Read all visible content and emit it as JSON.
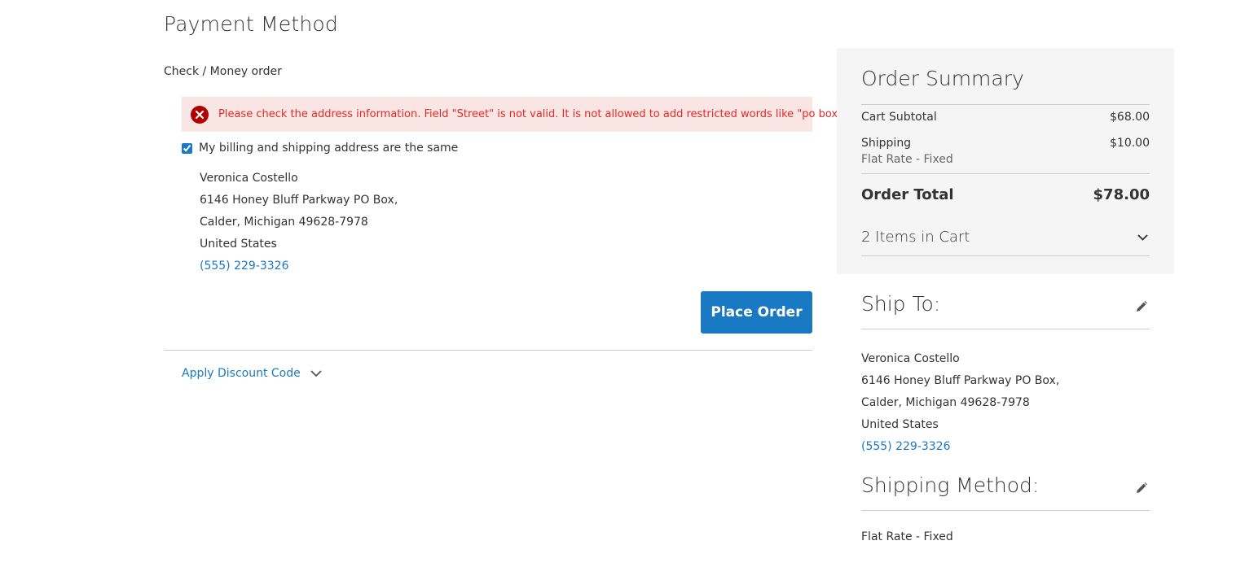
{
  "payment": {
    "title": "Payment Method",
    "method_label": "Check / Money order",
    "error_message": "Please check the address information. Field \"Street\" is not valid. It is not allowed to add restricted words like \"po box\".",
    "same_address_label": "My billing and shipping address are the same",
    "same_address_checked": true,
    "billing_address": {
      "name": "Veronica Costello",
      "street": "6146 Honey Bluff Parkway PO Box,",
      "city_line": "Calder, Michigan 49628-7978",
      "country": "United States",
      "phone": "(555) 229-3326"
    },
    "place_order_label": "Place Order",
    "discount_label": "Apply Discount Code"
  },
  "summary": {
    "title": "Order Summary",
    "subtotal_label": "Cart Subtotal",
    "subtotal_value": "$68.00",
    "shipping_label": "Shipping",
    "shipping_value": "$10.00",
    "shipping_method": "Flat Rate - Fixed",
    "total_label": "Order Total",
    "total_value": "$78.00",
    "items_label": "2 Items in Cart"
  },
  "ship_to": {
    "title": "Ship To:",
    "name": "Veronica Costello",
    "street": "6146 Honey Bluff Parkway PO Box,",
    "city_line": "Calder, Michigan 49628-7978",
    "country": "United States",
    "phone": "(555) 229-3326"
  },
  "shipping_method": {
    "title": "Shipping Method:",
    "value": "Flat Rate - Fixed"
  },
  "colors": {
    "accent": "#1979c3",
    "error_text": "#e02b27",
    "error_bg": "#fae5e5",
    "error_icon": "#b30000",
    "summary_bg": "#f5f5f5"
  },
  "icons": {
    "error": "error-circle-icon",
    "chevron": "chevron-down-icon",
    "edit": "pencil-icon"
  }
}
